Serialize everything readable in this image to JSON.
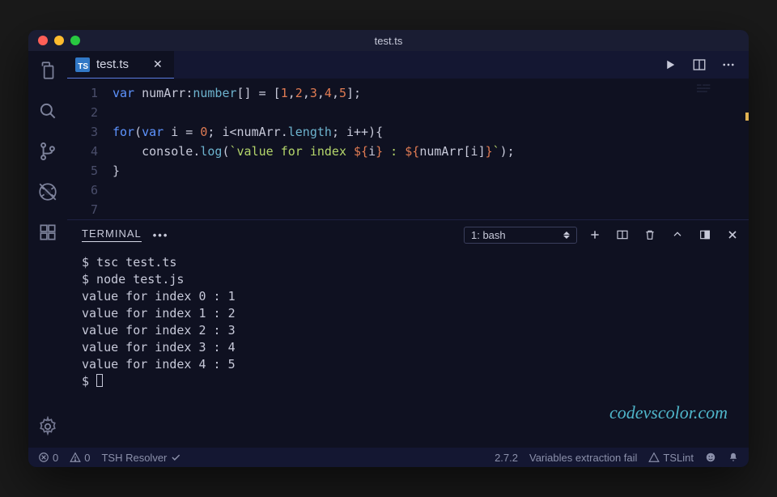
{
  "window": {
    "title": "test.ts"
  },
  "tab": {
    "filename": "test.ts",
    "badge": "TS"
  },
  "editor": {
    "line_numbers": [
      "1",
      "2",
      "3",
      "4",
      "5",
      "6",
      "7"
    ],
    "code_tokens": [
      [
        {
          "t": "var ",
          "c": "kw"
        },
        {
          "t": "numArr",
          "c": "id"
        },
        {
          "t": ":",
          "c": "pun"
        },
        {
          "t": "number",
          "c": "type"
        },
        {
          "t": "[] = [",
          "c": "pun"
        },
        {
          "t": "1",
          "c": "num"
        },
        {
          "t": ",",
          "c": "pun"
        },
        {
          "t": "2",
          "c": "num"
        },
        {
          "t": ",",
          "c": "pun"
        },
        {
          "t": "3",
          "c": "num"
        },
        {
          "t": ",",
          "c": "pun"
        },
        {
          "t": "4",
          "c": "num"
        },
        {
          "t": ",",
          "c": "pun"
        },
        {
          "t": "5",
          "c": "num"
        },
        {
          "t": "];",
          "c": "pun"
        }
      ],
      [],
      [
        {
          "t": "for",
          "c": "kw"
        },
        {
          "t": "(",
          "c": "pun"
        },
        {
          "t": "var ",
          "c": "kw"
        },
        {
          "t": "i",
          "c": "id"
        },
        {
          "t": " = ",
          "c": "pun"
        },
        {
          "t": "0",
          "c": "num"
        },
        {
          "t": "; ",
          "c": "pun"
        },
        {
          "t": "i",
          "c": "id"
        },
        {
          "t": "<",
          "c": "pun"
        },
        {
          "t": "numArr",
          "c": "id"
        },
        {
          "t": ".",
          "c": "pun"
        },
        {
          "t": "length",
          "c": "fn"
        },
        {
          "t": "; ",
          "c": "pun"
        },
        {
          "t": "i",
          "c": "id"
        },
        {
          "t": "++){",
          "c": "pun"
        }
      ],
      [
        {
          "t": "    ",
          "c": "pun"
        },
        {
          "t": "console",
          "c": "id"
        },
        {
          "t": ".",
          "c": "pun"
        },
        {
          "t": "log",
          "c": "fn"
        },
        {
          "t": "(",
          "c": "pun"
        },
        {
          "t": "`value for index ",
          "c": "str"
        },
        {
          "t": "${",
          "c": "tmpl"
        },
        {
          "t": "i",
          "c": "id"
        },
        {
          "t": "}",
          "c": "tmpl"
        },
        {
          "t": " : ",
          "c": "str"
        },
        {
          "t": "${",
          "c": "tmpl"
        },
        {
          "t": "numArr",
          "c": "id"
        },
        {
          "t": "[",
          "c": "pun"
        },
        {
          "t": "i",
          "c": "id"
        },
        {
          "t": "]",
          "c": "pun"
        },
        {
          "t": "}",
          "c": "tmpl"
        },
        {
          "t": "`",
          "c": "str"
        },
        {
          "t": ");",
          "c": "pun"
        }
      ],
      [
        {
          "t": "}",
          "c": "pun"
        }
      ],
      [],
      []
    ]
  },
  "panel": {
    "tab_label": "TERMINAL",
    "selector": "1: bash",
    "lines": [
      "$ tsc test.ts",
      "$ node test.js",
      "value for index 0 : 1",
      "value for index 1 : 2",
      "value for index 2 : 3",
      "value for index 3 : 4",
      "value for index 4 : 5"
    ],
    "prompt": "$ "
  },
  "statusbar": {
    "errors": "0",
    "warnings": "0",
    "resolver": "TSH Resolver",
    "version": "2.7.2",
    "message": "Variables extraction fail",
    "linter": "TSLint"
  },
  "watermark": "codevscolor.com"
}
